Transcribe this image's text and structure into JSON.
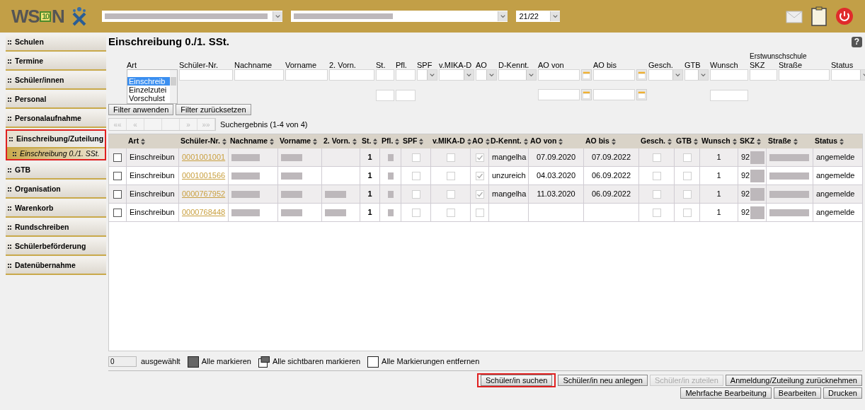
{
  "header": {
    "logo_start": "WS",
    "logo_badge": "10",
    "logo_end": "N",
    "school_year": "21/22"
  },
  "sidebar": {
    "items": [
      {
        "label": "Schulen",
        "selected": false,
        "highlighted": false
      },
      {
        "label": "Termine",
        "selected": false,
        "highlighted": false
      },
      {
        "label": "Schüler/innen",
        "selected": false,
        "highlighted": false
      },
      {
        "label": "Personal",
        "selected": false,
        "highlighted": false
      },
      {
        "label": "Personalaufnahme",
        "selected": false,
        "highlighted": false
      },
      {
        "label": "Einschreibung/Zuteilung",
        "selected": true,
        "highlighted": true,
        "children": [
          {
            "label": "Einschreibung 0./1. SSt.",
            "selected": true
          }
        ]
      },
      {
        "label": "GTB",
        "selected": false,
        "highlighted": false
      },
      {
        "label": "Organisation",
        "selected": false,
        "highlighted": false
      },
      {
        "label": "Warenkorb",
        "selected": false,
        "highlighted": false
      },
      {
        "label": "Rundschreiben",
        "selected": false,
        "highlighted": false
      },
      {
        "label": "Schülerbeförderung",
        "selected": false,
        "highlighted": false
      },
      {
        "label": "Datenübernahme",
        "selected": false,
        "highlighted": false
      }
    ]
  },
  "page": {
    "title": "Einschreibung 0./1. SSt.",
    "help": "?"
  },
  "filters": {
    "group_label": "Erstwunschschule",
    "fields": [
      {
        "label": "Art",
        "kind": "listbox",
        "options": [
          {
            "label": "Einschreib",
            "selected": true
          },
          {
            "label": "Einzelzutei",
            "selected": false
          },
          {
            "label": "Vorschulst",
            "selected": false
          }
        ]
      },
      {
        "label": "Schüler-Nr.",
        "kind": "text"
      },
      {
        "label": "Nachname",
        "kind": "text"
      },
      {
        "label": "Vorname",
        "kind": "text"
      },
      {
        "label": "2. Vorn.",
        "kind": "text"
      },
      {
        "label": "St.",
        "kind": "text",
        "range": true
      },
      {
        "label": "Pfl.",
        "kind": "text",
        "range": true
      },
      {
        "label": "SPF",
        "kind": "select"
      },
      {
        "label": "v.MIKA-D",
        "kind": "select"
      },
      {
        "label": "AO",
        "kind": "select"
      },
      {
        "label": "D-Kennt.",
        "kind": "select"
      },
      {
        "label": "AO von",
        "kind": "date",
        "range": true
      },
      {
        "label": "AO bis",
        "kind": "date",
        "range": true
      },
      {
        "label": "Gesch.",
        "kind": "select"
      },
      {
        "label": "GTB",
        "kind": "select"
      },
      {
        "label": "Wunsch",
        "kind": "text",
        "range": true
      },
      {
        "label": "SKZ",
        "kind": "text",
        "group_start": true
      },
      {
        "label": "Straße",
        "kind": "text"
      },
      {
        "label": "Status",
        "kind": "select"
      }
    ],
    "buttons": [
      "Filter anwenden",
      "Filter zurücksetzen"
    ]
  },
  "pager": {
    "first": "««",
    "prev": "«",
    "next": "»",
    "last": "»»",
    "result": "Suchergebnis (1-4 von 4)"
  },
  "table": {
    "columns": [
      "Art",
      "Schüler-Nr.",
      "Nachname",
      "Vorname",
      "2. Vorn.",
      "St.",
      "Pfl.",
      "SPF",
      "v.MIKA-D",
      "AO",
      "D-Kennt.",
      "AO von",
      "AO bis",
      "Gesch.",
      "GTB",
      "Wunsch",
      "SKZ",
      "Straße",
      "Status"
    ],
    "rows": [
      {
        "checked": false,
        "art": "Einschreibun",
        "nr": "0001001001",
        "second_name_redacted": false,
        "st": "1",
        "spf": false,
        "mika": false,
        "ao": true,
        "dkennt": "mangelha",
        "ao_von": "07.09.2020",
        "ao_bis": "07.09.2022",
        "gesch": false,
        "gtb": false,
        "wunsch": "1",
        "skz": "92",
        "status": "angemelde"
      },
      {
        "checked": false,
        "art": "Einschreibun",
        "nr": "0001001566",
        "second_name_redacted": false,
        "st": "1",
        "spf": false,
        "mika": false,
        "ao": true,
        "dkennt": "unzureich",
        "ao_von": "04.03.2020",
        "ao_bis": "06.09.2022",
        "gesch": false,
        "gtb": false,
        "wunsch": "1",
        "skz": "92",
        "status": "angemelde"
      },
      {
        "checked": false,
        "art": "Einschreibun",
        "nr": "0000767952",
        "second_name_redacted": true,
        "st": "1",
        "spf": false,
        "mika": false,
        "ao": true,
        "dkennt": "mangelha",
        "ao_von": "11.03.2020",
        "ao_bis": "06.09.2022",
        "gesch": false,
        "gtb": false,
        "wunsch": "1",
        "skz": "92",
        "status": "angemelde"
      },
      {
        "checked": false,
        "art": "Einschreibun",
        "nr": "0000768448",
        "second_name_redacted": true,
        "st": "1",
        "spf": false,
        "mika": false,
        "ao": false,
        "gesch": false,
        "gtb": false,
        "wunsch": "1",
        "skz": "92",
        "status": "angemelde"
      }
    ]
  },
  "selection": {
    "count": "0",
    "count_label": "ausgewählt",
    "actions": [
      {
        "kind": "all",
        "label": "Alle markieren"
      },
      {
        "kind": "visible",
        "label": "Alle sichtbaren markieren"
      },
      {
        "kind": "none",
        "label": "Alle Markierungen entfernen"
      }
    ]
  },
  "actions": [
    [
      {
        "label": "Schüler/in suchen",
        "disabled": false,
        "highlighted": true
      },
      {
        "label": "Schüler/in neu anlegen",
        "disabled": false,
        "highlighted": false
      },
      {
        "label": "Schüler/in zuteilen",
        "disabled": true,
        "highlighted": false
      },
      {
        "label": "Anmeldung/Zuteilung zurücknehmen",
        "disabled": false,
        "highlighted": false
      }
    ],
    [
      {
        "label": "Mehrfache Bearbeitung",
        "disabled": false,
        "highlighted": false
      },
      {
        "label": "Bearbeiten",
        "disabled": false,
        "highlighted": false
      },
      {
        "label": "Drucken",
        "disabled": false,
        "highlighted": false
      }
    ]
  ]
}
